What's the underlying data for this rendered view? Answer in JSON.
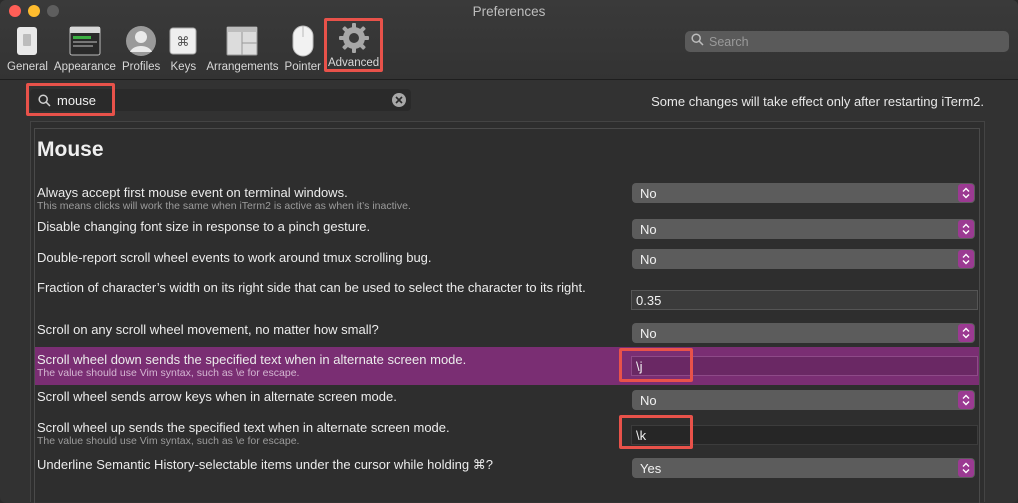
{
  "window": {
    "title": "Preferences"
  },
  "toolbar": {
    "items": [
      {
        "label": "General",
        "icon": "general-icon"
      },
      {
        "label": "Appearance",
        "icon": "appearance-icon"
      },
      {
        "label": "Profiles",
        "icon": "profiles-icon"
      },
      {
        "label": "Keys",
        "icon": "keys-icon"
      },
      {
        "label": "Arrangements",
        "icon": "arrangements-icon"
      },
      {
        "label": "Pointer",
        "icon": "pointer-icon"
      },
      {
        "label": "Advanced",
        "icon": "gear-icon",
        "selected": true
      }
    ],
    "search_placeholder": "Search"
  },
  "filter": {
    "value": "mouse",
    "placeholder": ""
  },
  "notice": "Some changes will take effect only after restarting iTerm2.",
  "section": {
    "title": "Mouse"
  },
  "settings": [
    {
      "title": "Always accept first mouse event on terminal windows.",
      "subtitle": "This means clicks will work the same when iTerm2 is active as when it’s inactive.",
      "kind": "select",
      "value": "No"
    },
    {
      "title": "Disable changing font size in response to a pinch gesture.",
      "subtitle": "",
      "kind": "select",
      "value": "No"
    },
    {
      "title": "Double-report scroll wheel events to work around tmux scrolling bug.",
      "subtitle": "",
      "kind": "select",
      "value": "No"
    },
    {
      "title": "Fraction of character’s width on its right side that can be used to select the character to its right.",
      "subtitle": "",
      "kind": "text",
      "value": "0.35"
    },
    {
      "title": "Scroll on any scroll wheel movement, no matter how small?",
      "subtitle": "",
      "kind": "select",
      "value": "No"
    },
    {
      "title": "Scroll wheel down sends the specified text when in alternate screen mode.",
      "subtitle": "The value should use Vim syntax, such as \\e for escape.",
      "kind": "text",
      "value": "\\j",
      "selected": true
    },
    {
      "title": "Scroll wheel sends arrow keys when in alternate screen mode.",
      "subtitle": "",
      "kind": "select",
      "value": "No"
    },
    {
      "title": "Scroll wheel up sends the specified text when in alternate screen mode.",
      "subtitle": "The value should use Vim syntax, such as \\e for escape.",
      "kind": "text",
      "value": "\\k"
    },
    {
      "title": "Underline Semantic History-selectable items under the cursor while holding ⌘?",
      "subtitle": "",
      "kind": "select",
      "value": "Yes"
    }
  ],
  "colors": {
    "accent": "#9b3a92",
    "selection": "#7a2e73",
    "annotation": "#e8524a"
  }
}
